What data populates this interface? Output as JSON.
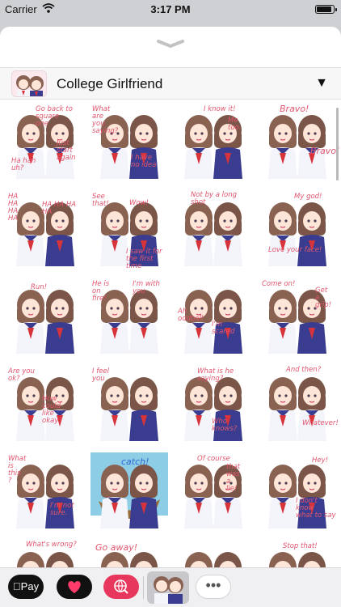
{
  "status_bar": {
    "carrier": "Carrier",
    "time": "3:17 PM",
    "battery_level": 0.9
  },
  "header": {
    "title": "College Girlfriend",
    "collapse_glyph": "▼"
  },
  "drawer": {
    "apple_pay_label": "Pay",
    "more_glyph": "•••"
  },
  "stickers": [
    {
      "captions": [
        "Go back to\nsquare\none",
        "Ha hah\nuh?",
        "Just\nstart\nagain"
      ]
    },
    {
      "captions": [
        "What\nare\nyou\nsaying?",
        "I have\nno idea"
      ]
    },
    {
      "captions": [
        "I know it!",
        "Me\ntoo."
      ]
    },
    {
      "captions": [
        "Bravo!",
        "Bravo!"
      ]
    },
    {
      "captions": [
        "HA\nHA\nHA\nHA",
        "HA HA HA\nHA"
      ]
    },
    {
      "captions": [
        "See\nthat!",
        "Wow!",
        "I saw it for\nthe first time"
      ]
    },
    {
      "captions": [
        "Not by a long\nshot"
      ]
    },
    {
      "captions": [
        "My god!",
        "Love your face!"
      ]
    },
    {
      "captions": [
        "Run!"
      ]
    },
    {
      "captions": [
        "He is\non\nfire!",
        "I'm with\nyou"
      ]
    },
    {
      "captions": [
        "Ah\noddball",
        "I'm\nscared"
      ]
    },
    {
      "captions": [
        "Come on!",
        "Get\na\ngrip!"
      ]
    },
    {
      "captions": [
        "Are you\nok?",
        "How\ncould\nlike\nokay?"
      ]
    },
    {
      "captions": [
        "I feel\nyou"
      ]
    },
    {
      "captions": [
        "What is he saying?",
        "Who knows?"
      ]
    },
    {
      "captions": [
        "And then?",
        "Whatever!"
      ]
    },
    {
      "captions": [
        "What\nis\nthis\n?",
        "I'm not\nsure."
      ]
    },
    {
      "captions": [
        "catch!"
      ]
    },
    {
      "captions": [
        "Of course",
        "that\nwas\na\nlie!"
      ]
    },
    {
      "captions": [
        "Hey!",
        "I don't know\nwhat to say"
      ]
    },
    {
      "captions": [
        "What's wrong?"
      ]
    },
    {
      "captions": [
        "Go away!"
      ]
    },
    {
      "captions": []
    },
    {
      "captions": [
        "Stop that!"
      ]
    }
  ],
  "colors": {
    "accent_pink": "#e0566e",
    "uniform_navy": "#3a3d8f",
    "hair_brown": "#8a6252",
    "scarf_red": "#d8323b"
  }
}
